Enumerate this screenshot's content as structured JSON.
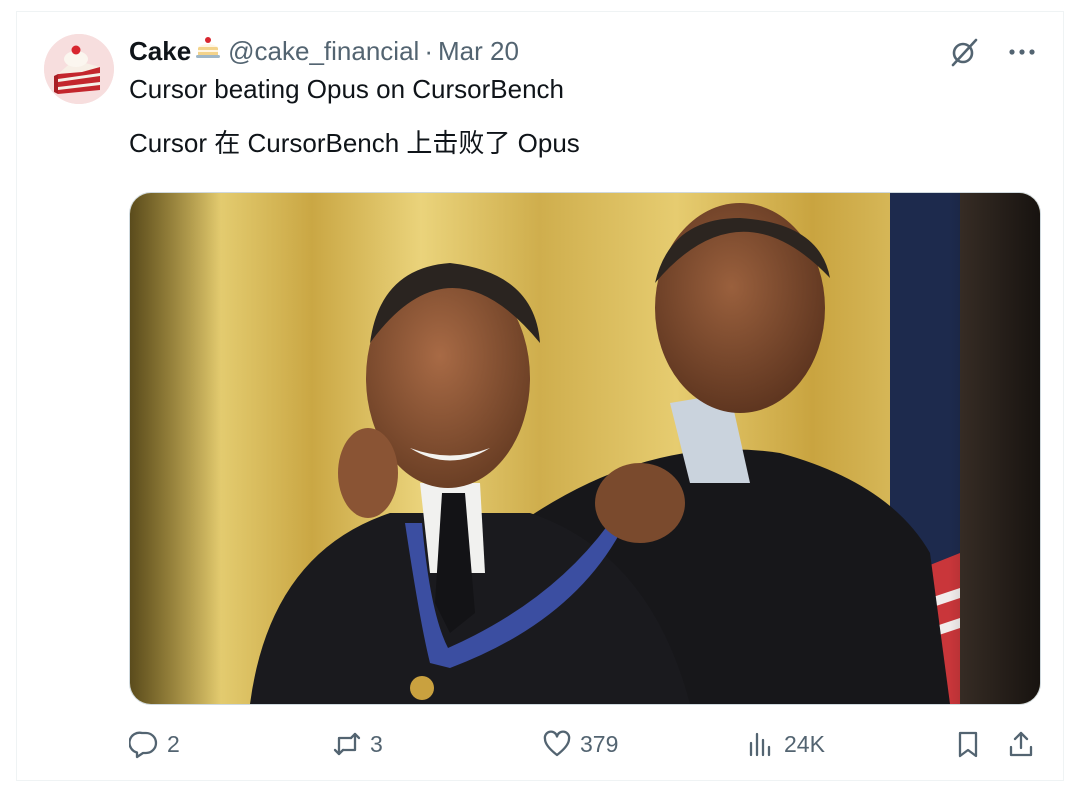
{
  "tweet": {
    "author": {
      "display_name": "Cake",
      "name_emoji": "cake-emoji",
      "handle": "@cake_financial"
    },
    "separator": "·",
    "date": "Mar 20",
    "text_lines": [
      "Cursor beating Opus on CursorBench",
      "Cursor 在 CursorBench 上击败了 Opus"
    ],
    "media": {
      "type": "photo",
      "icon": "photo-medal-ceremony"
    },
    "metrics": {
      "replies": "2",
      "reposts": "3",
      "likes": "379",
      "views": "24K"
    },
    "icons": {
      "grok": "grok-icon",
      "more": "more-icon",
      "reply": "reply-icon",
      "repost": "repost-icon",
      "like": "heart-icon",
      "views": "views-icon",
      "bookmark": "bookmark-icon",
      "share": "share-icon"
    },
    "colors": {
      "text": "#0f1419",
      "secondary": "#536471",
      "border": "#eff3f4"
    }
  }
}
